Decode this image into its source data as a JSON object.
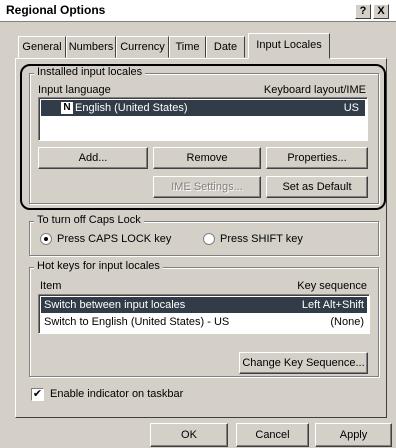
{
  "window": {
    "title": "Regional Options",
    "help_button": "?",
    "close_button": "X"
  },
  "tabs": [
    {
      "label": "General"
    },
    {
      "label": "Numbers"
    },
    {
      "label": "Currency"
    },
    {
      "label": "Time"
    },
    {
      "label": "Date"
    },
    {
      "label": "Input Locales"
    }
  ],
  "installed": {
    "group_label": "Installed input locales",
    "col_language": "Input language",
    "col_layout": "Keyboard layout/IME",
    "items": [
      {
        "badge": "N",
        "language": "English (United States)",
        "layout": "US"
      }
    ],
    "add_label": "Add...",
    "remove_label": "Remove",
    "properties_label": "Properties...",
    "ime_label": "IME Settings...",
    "default_label": "Set as Default"
  },
  "caps": {
    "group_label": "To turn off Caps Lock",
    "option1": "Press CAPS LOCK key",
    "option2": "Press SHIFT key"
  },
  "hotkeys": {
    "group_label": "Hot keys for input locales",
    "col_item": "Item",
    "col_seq": "Key sequence",
    "items": [
      {
        "item": "Switch between input locales",
        "seq": "Left Alt+Shift"
      },
      {
        "item": "Switch to English (United States) - US",
        "seq": "(None)"
      }
    ],
    "change_label": "Change Key Sequence..."
  },
  "indicator": {
    "label": "Enable indicator on taskbar",
    "check": "✔"
  },
  "footer": {
    "ok_label": "OK",
    "cancel_label": "Cancel",
    "apply_label": "Apply"
  }
}
